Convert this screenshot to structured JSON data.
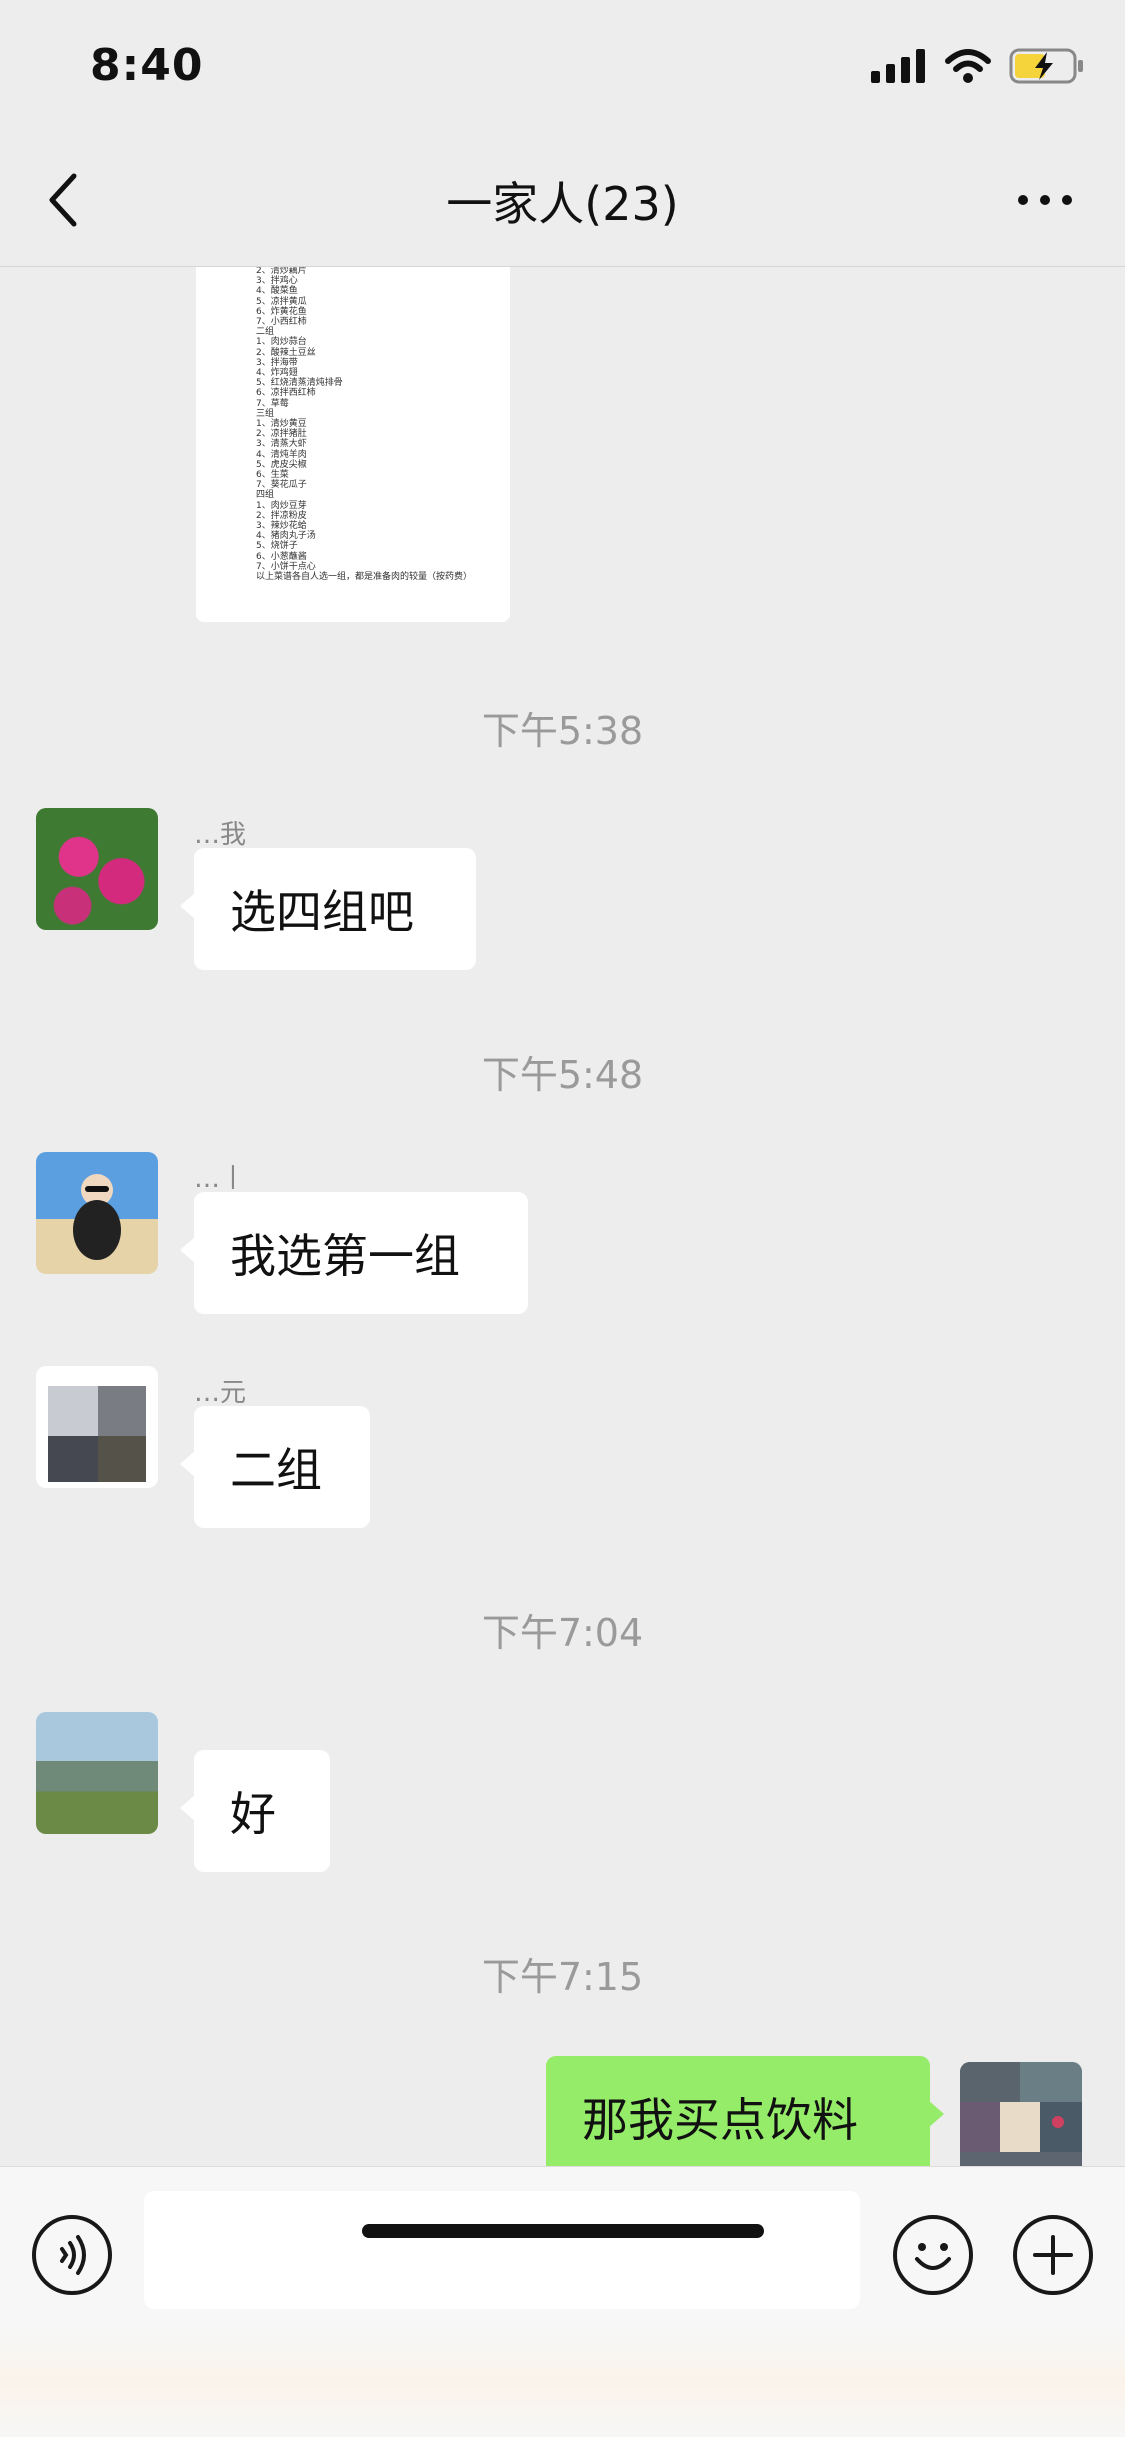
{
  "status_bar": {
    "time": "8:40"
  },
  "nav": {
    "title": "一家人(23)"
  },
  "document_preview": {
    "lines": [
      "2、清炒藕片",
      "3、拌鸡心",
      "4、酸菜鱼",
      "5、凉拌黄瓜",
      "6、炸黄花鱼",
      "7、小西红柿",
      "二组",
      "1、肉炒蒜台",
      "2、酸辣土豆丝",
      "3、拌海带",
      "4、炸鸡翅",
      "5、红烧清蒸清炖排骨",
      "6、凉拌西红柿",
      "7、草莓",
      "三组",
      "1、清炒黄豆",
      "2、凉拌猪肚",
      "3、清蒸大虾",
      "4、清炖羊肉",
      "5、虎皮尖椒",
      "6、生菜",
      "7、葵花瓜子",
      "四组",
      "1、肉炒豆芽",
      "2、拌凉粉皮",
      "3、辣炒花蛤",
      "4、猪肉丸子汤",
      "5、烧饼子",
      "6、小葱蘸酱",
      "7、小饼干点心",
      "以上菜谱各自人选一组，都是准备肉的较量（按药费）"
    ]
  },
  "messages": [
    {
      "type": "timestamp",
      "text": "下午5:38"
    },
    {
      "type": "incoming",
      "sender": "…我",
      "text": "选四组吧"
    },
    {
      "type": "timestamp",
      "text": "下午5:48"
    },
    {
      "type": "incoming",
      "sender": "…丨",
      "text": "我选第一组"
    },
    {
      "type": "incoming",
      "sender": "…元",
      "text": "二组"
    },
    {
      "type": "timestamp",
      "text": "下午7:04"
    },
    {
      "type": "incoming",
      "sender": "",
      "text": "好"
    },
    {
      "type": "timestamp",
      "text": "下午7:15"
    },
    {
      "type": "outgoing",
      "text": "那我买点饮料"
    }
  ],
  "input": {
    "placeholder": ""
  },
  "icons": {
    "back": "chevron-left-icon",
    "more": "more-dots-icon",
    "voice": "voice-icon",
    "emoji": "emoji-icon",
    "plus": "plus-icon",
    "signal": "signal-icon",
    "wifi": "wifi-icon",
    "battery": "battery-charging-icon"
  },
  "colors": {
    "background": "#ededed",
    "outgoing_bubble": "#95ec69",
    "incoming_bubble": "#ffffff",
    "battery": "#f5d33a"
  }
}
